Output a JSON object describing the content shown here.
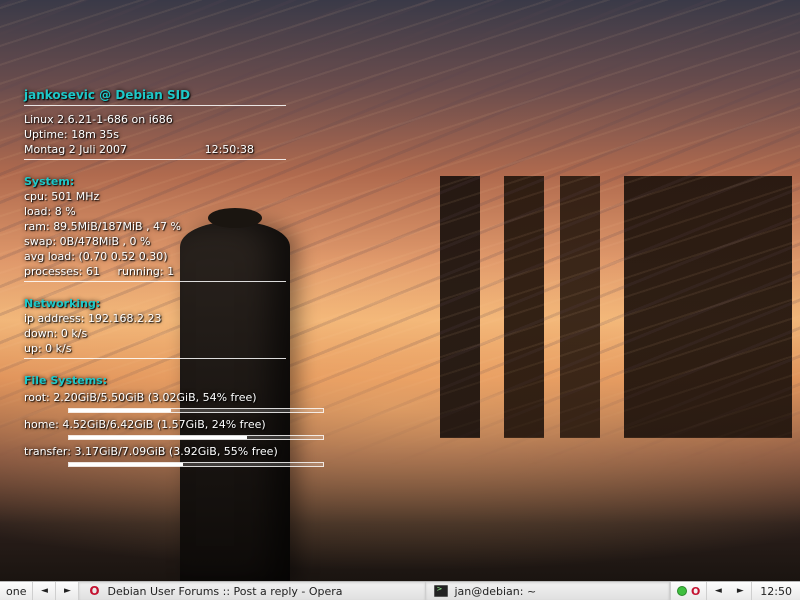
{
  "conky": {
    "title": "jankosevic @ Debian SID",
    "kernel_line": "Linux 2.6.21-1-686 on i686",
    "uptime_label": "Uptime:",
    "uptime_value": "18m 35s",
    "date": "Montag  2 Juli 2007",
    "time": "12:50:38",
    "system": {
      "heading": "System:",
      "cpu_label": "cpu:",
      "cpu_value": "501 MHz",
      "load_label": "load:",
      "load_value": "8  %",
      "ram_label": "ram:",
      "ram_value": "89.5MiB/187MiB , 47 %",
      "swap_label": "swap:",
      "swap_value": "0B/478MiB , 0  %",
      "avgload_label": "avg load:",
      "avgload_value": "(0.70 0.52 0.30)",
      "processes_label": "processes:",
      "processes_value": "61",
      "running_label": "running:",
      "running_value": "1"
    },
    "network": {
      "heading": "Networking:",
      "ip_label": "ip address:",
      "ip_value": "192.168.2.23",
      "down_label": "down:",
      "down_value": "0    k/s",
      "up_label": "up:",
      "up_value": "0   k/s"
    },
    "fs": {
      "heading": "File Systems:",
      "root_label": "root:",
      "root_value": "2.20GiB/5.50GiB (3.02GiB, 54% free)",
      "root_fill_pct": 40,
      "home_label": "home:",
      "home_value": "4.52GiB/6.42GiB (1.57GiB, 24% free)",
      "home_fill_pct": 70,
      "transfer_label": "transfer:",
      "transfer_value": "3.17GiB/7.09GiB (3.92GiB, 55% free)",
      "transfer_fill_pct": 45
    }
  },
  "taskbar": {
    "workspace": "one",
    "prev_glyph": "◄",
    "next_glyph": "►",
    "task1": "Debian User Forums :: Post a reply - Opera",
    "task2": "jan@debian: ~",
    "clock": "12:50"
  }
}
